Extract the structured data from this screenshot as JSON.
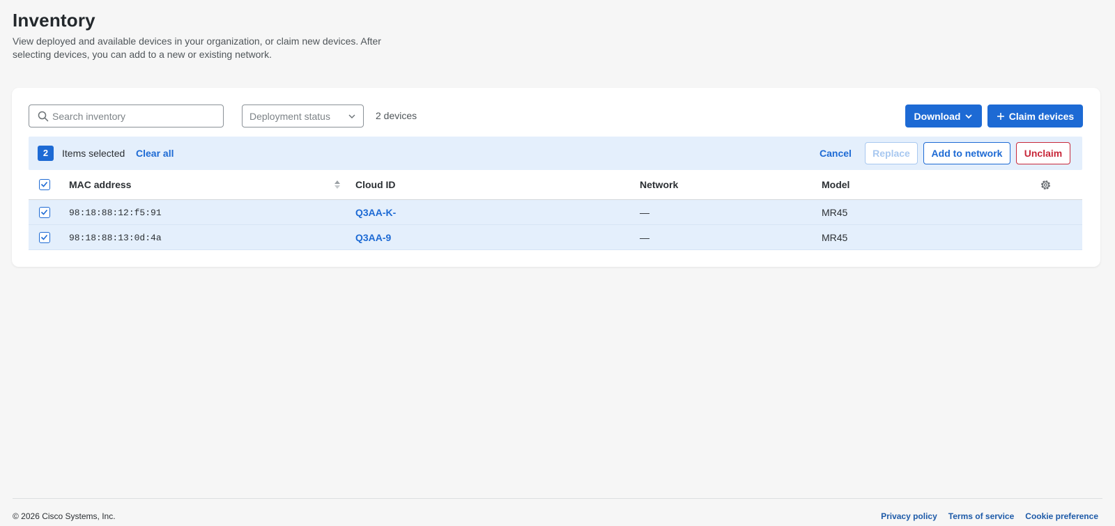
{
  "header": {
    "title": "Inventory",
    "description": "View deployed and available devices in your organization, or claim new devices. After selecting devices, you can add to a new or existing network."
  },
  "toolbar": {
    "search_placeholder": "Search inventory",
    "deployment_status": "Deployment status",
    "device_count": "2 devices",
    "download_label": "Download",
    "claim_label": "Claim devices"
  },
  "selection": {
    "count": "2",
    "items_selected": "Items selected",
    "clear_all": "Clear all",
    "cancel": "Cancel",
    "replace": "Replace",
    "add_to_network": "Add to network",
    "unclaim": "Unclaim"
  },
  "table": {
    "columns": [
      "MAC address",
      "Cloud ID",
      "Network",
      "Model"
    ],
    "rows": [
      {
        "mac": "98:18:88:12:f5:91",
        "cloud_id": "Q3AA-K-",
        "network": "—",
        "model": "MR45",
        "checked": true
      },
      {
        "mac": "98:18:88:13:0d:4a",
        "cloud_id": "Q3AA-9",
        "network": "—",
        "model": "MR45",
        "checked": true
      }
    ]
  },
  "footer": {
    "copyright": "© 2026 Cisco Systems, Inc.",
    "links": [
      "Privacy policy",
      "Terms of service",
      "Cookie preference"
    ]
  },
  "colors": {
    "primary": "#1d6ad4",
    "danger": "#c8283a",
    "selection_bg": "#e4effc",
    "page_bg": "#f6f6f6"
  }
}
